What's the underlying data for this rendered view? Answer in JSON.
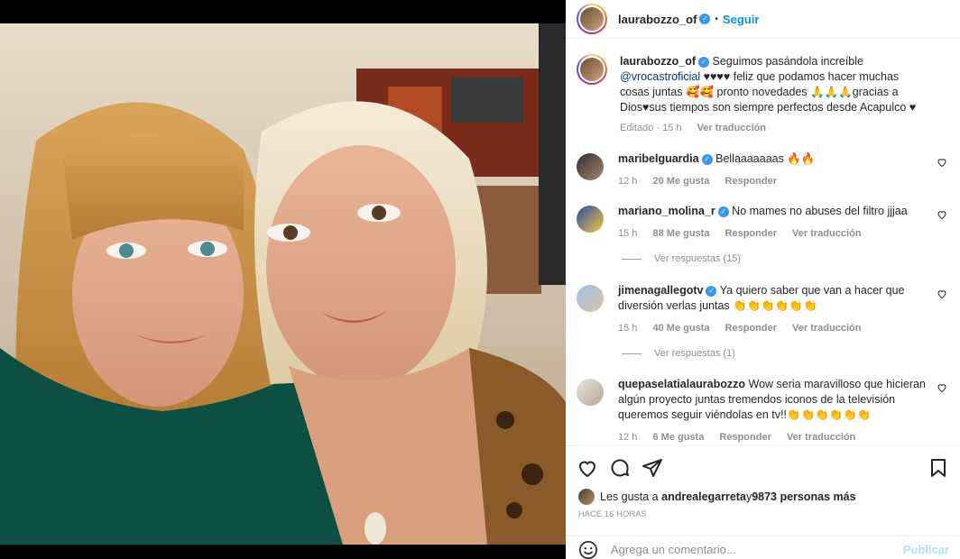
{
  "post": {
    "username": "laurabozzo_of",
    "follow_label": "Seguir",
    "dot": "•",
    "caption_user": "laurabozzo_of",
    "caption_text": " Seguimos pasándola increíble ",
    "caption_mention": "@vrocastroficial",
    "caption_rest": " ♥♥♥♥ feliz que podamos hacer muchas cosas juntas 🥰🥰 pronto novedades 🙏🙏🙏gracias a Dios♥sus tiempos son siempre perfectos desde Acapulco ♥",
    "caption_edited": "Editado · 15 h",
    "caption_translate": "Ver traducción"
  },
  "comments": [
    {
      "user": "maribelguardia",
      "verified": true,
      "text": "Bellaaaaaaas 🔥🔥",
      "time": "12 h",
      "likes": "20 Me gusta",
      "reply": "Responder",
      "translate": ""
    },
    {
      "user": "mariano_molina_r",
      "verified": true,
      "text": "No mames no abuses del filtro jjjaa",
      "time": "15 h",
      "likes": "88 Me gusta",
      "reply": "Responder",
      "translate": "Ver traducción"
    },
    {
      "user": "jimenagallegotv",
      "verified": true,
      "text": "Ya quiero saber que van a hacer que diversión verlas juntas 👏👏👏👏👏👏",
      "time": "15 h",
      "likes": "40 Me gusta",
      "reply": "Responder",
      "translate": "Ver traducción"
    },
    {
      "user": "quepaselatialaurabozzo",
      "verified": false,
      "text": "Wow seria maravilloso que hicieran algún proyecto juntas tremendos iconos de la televisión queremos seguir viéndolas en tv!!👏👏👏👏👏👏",
      "time": "12 h",
      "likes": "6 Me gusta",
      "reply": "Responder",
      "translate": "Ver traducción"
    }
  ],
  "replies": [
    {
      "label": "Ver respuestas (15)"
    },
    {
      "label": "Ver respuestas (1)"
    }
  ],
  "likes_line": {
    "prefix": "Les gusta a ",
    "user": "andrealegarreta",
    "middle": " y ",
    "count": "9873 personas más"
  },
  "time_ago": "HACE 16 HORAS",
  "compose": {
    "placeholder": "Agrega un comentario...",
    "publish": "Publicar"
  },
  "icons": [
    "heart-icon",
    "comment-icon",
    "share-icon",
    "bookmark-icon",
    "emoji-icon",
    "verified-icon"
  ],
  "colors": {
    "accent": "#0095f6",
    "verified": "#3897f0",
    "muted": "#8e8e8e"
  }
}
